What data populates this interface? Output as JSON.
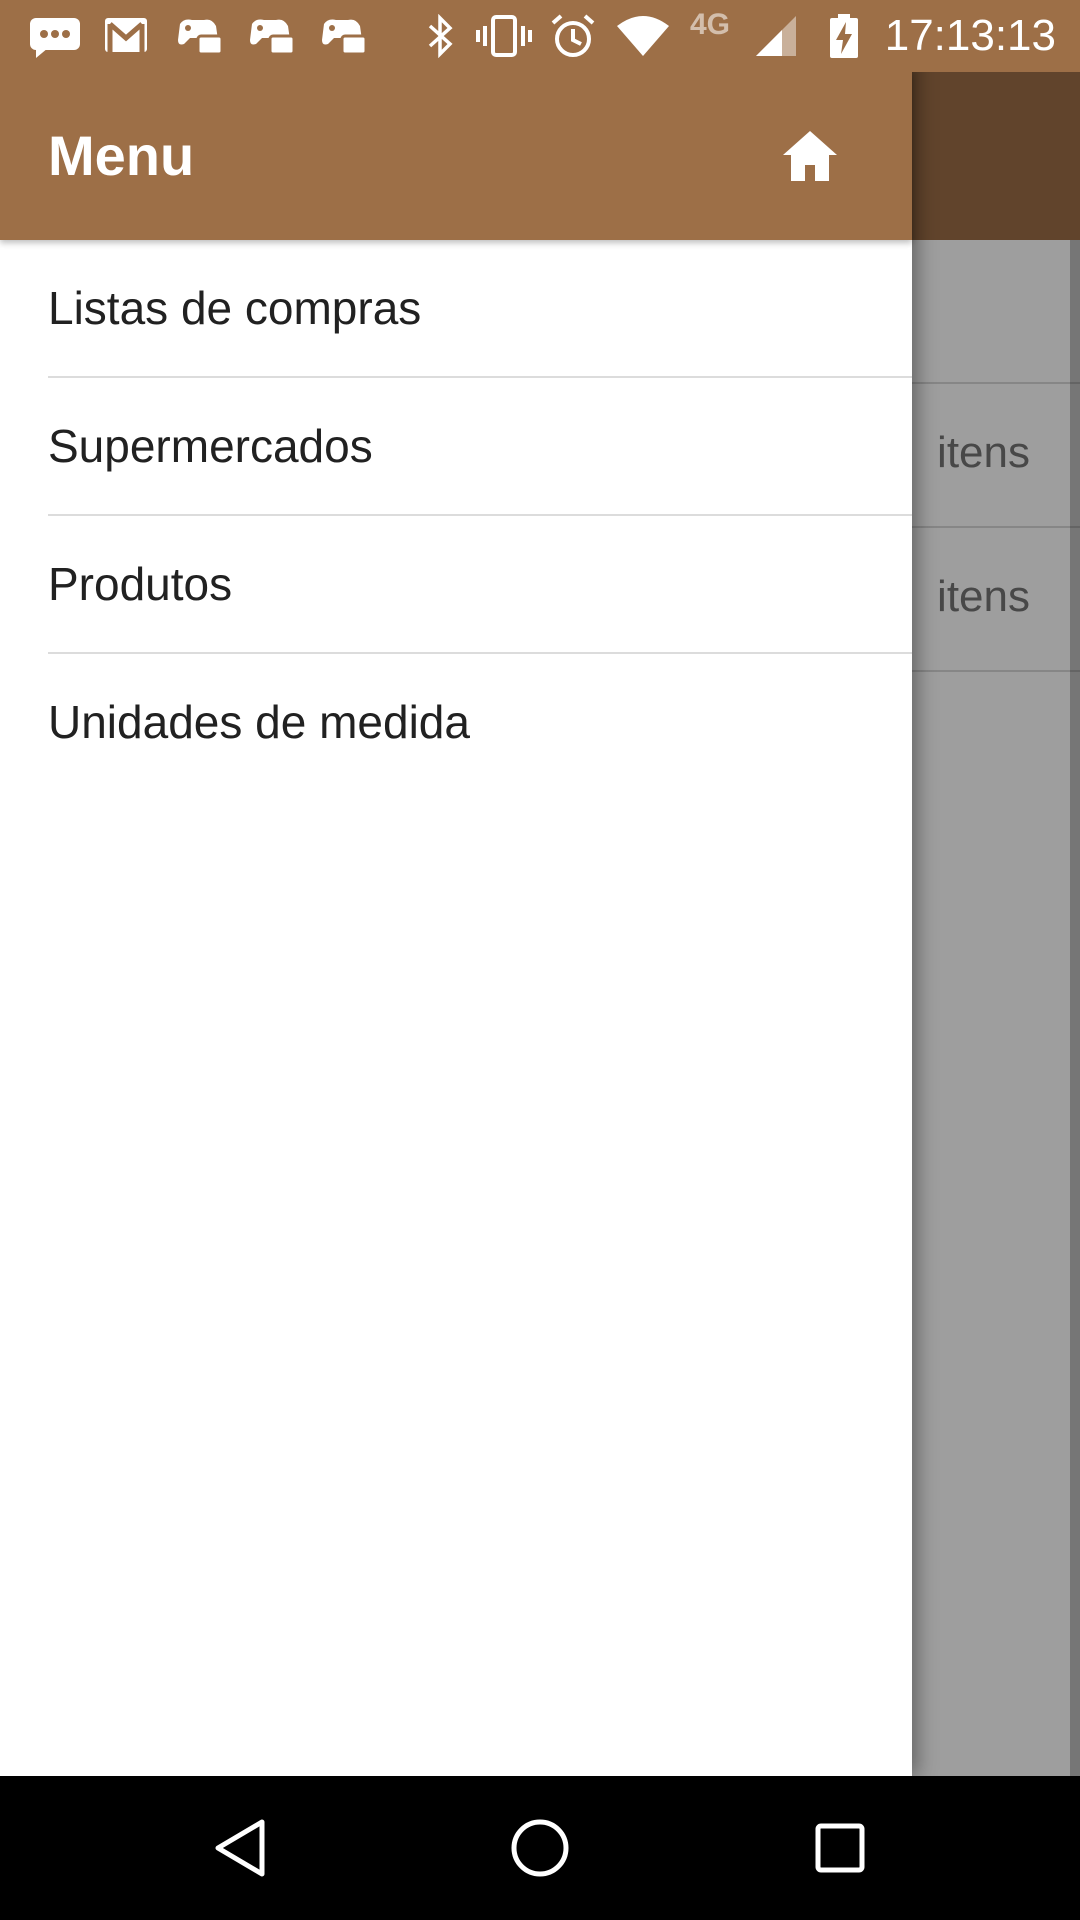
{
  "status_bar": {
    "time": "17:13:13",
    "network_label": "4G",
    "icons": [
      "messaging-icon",
      "gmail-icon",
      "game-controller-icon",
      "game-controller-icon",
      "game-controller-icon",
      "bluetooth-icon",
      "vibrate-icon",
      "alarm-icon",
      "wifi-icon",
      "cell-signal-icon",
      "battery-charging-icon"
    ]
  },
  "drawer": {
    "title": "Menu",
    "home_icon": "home-icon",
    "items": [
      {
        "label": "Listas de compras"
      },
      {
        "label": "Supermercados"
      },
      {
        "label": "Produtos"
      },
      {
        "label": "Unidades de medida"
      }
    ]
  },
  "background_list": {
    "rows": [
      {
        "text": "itens"
      },
      {
        "text": "itens"
      }
    ]
  },
  "nav_bar": {
    "icons": [
      "back-icon",
      "home-circle-icon",
      "recents-icon"
    ]
  },
  "colors": {
    "primary": "#9d6f47",
    "drawer_bg": "#ffffff",
    "text": "#212121",
    "divider": "#dcdcdc"
  }
}
